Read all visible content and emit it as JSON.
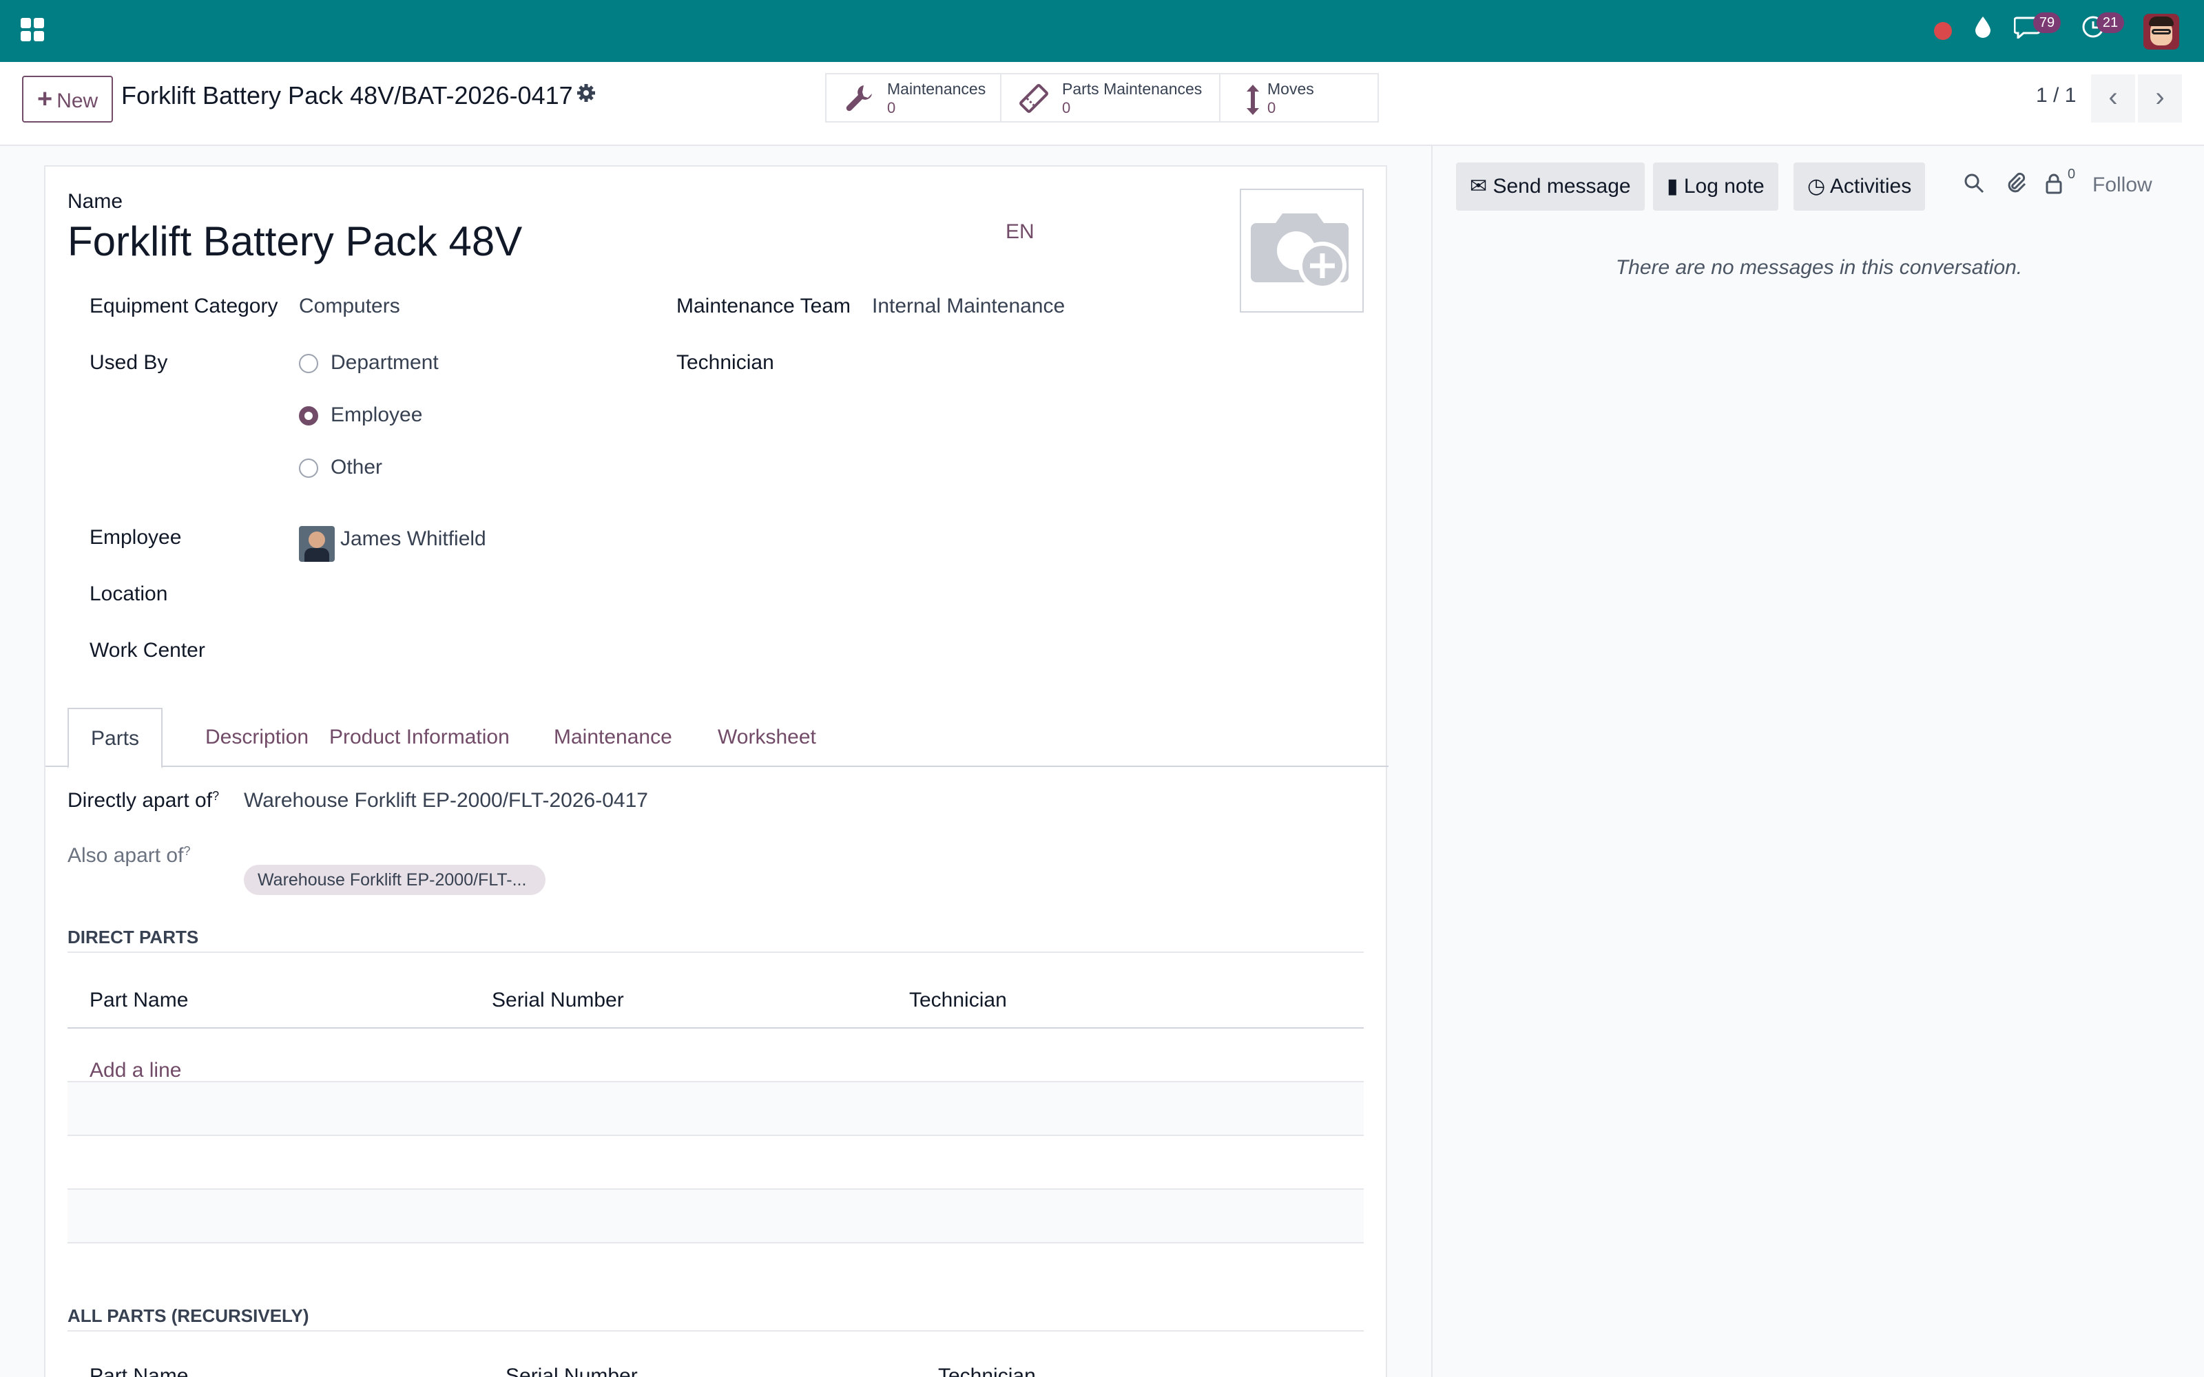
{
  "navbar": {
    "apps_icon": "apps-grid-icon",
    "icons": [
      "record-dot-icon",
      "drop-icon",
      "chat-bubble-icon",
      "clock-icon"
    ],
    "messages_badge": "79",
    "activities_badge": "21",
    "brand_color": "#017e84"
  },
  "control": {
    "new_label": "New",
    "breadcrumb": "Forklift Battery Pack 48V/BAT-2026-0417",
    "smart_buttons": [
      {
        "label": "Maintenances",
        "value": "0",
        "icon": "wrench-icon"
      },
      {
        "label": "Parts Maintenances",
        "value": "0",
        "icon": "ticket-icon"
      },
      {
        "label": "Moves",
        "value": "0",
        "icon": "arrows-vertical-icon"
      }
    ],
    "pager": "1 / 1"
  },
  "form": {
    "name_label": "Name",
    "name_value": "Forklift Battery Pack 48V",
    "lang": "EN",
    "equipment_category_label": "Equipment Category",
    "equipment_category_value": "Computers",
    "maintenance_team_label": "Maintenance Team",
    "maintenance_team_value": "Internal Maintenance",
    "technician_label": "Technician",
    "used_by_label": "Used By",
    "used_by_options": [
      "Department",
      "Employee",
      "Other"
    ],
    "used_by_selected": "Employee",
    "employee_label": "Employee",
    "employee_value": "James Whitfield",
    "location_label": "Location",
    "work_center_label": "Work Center",
    "accent_color": "#714b67"
  },
  "tabs": [
    "Parts",
    "Description",
    "Product Information",
    "Maintenance",
    "Worksheet"
  ],
  "parts": {
    "directly_apart_of_label": "Directly apart of",
    "directly_apart_of_value": "Warehouse Forklift EP-2000/FLT-2026-0417",
    "also_apart_of_label": "Also apart of",
    "also_apart_of_tag": "Warehouse Forklift EP-2000/FLT-...",
    "help_mark": "?",
    "direct_parts_title": "DIRECT PARTS",
    "columns": [
      "Part Name",
      "Serial Number",
      "Technician"
    ],
    "add_line": "Add a line",
    "all_parts_title": "ALL PARTS (RECURSIVELY)"
  },
  "chatter": {
    "send_message": "Send message",
    "log_note": "Log note",
    "activities": "Activities",
    "followers_count": "0",
    "follow": "Follow",
    "empty_message": "There are no messages in this conversation."
  }
}
